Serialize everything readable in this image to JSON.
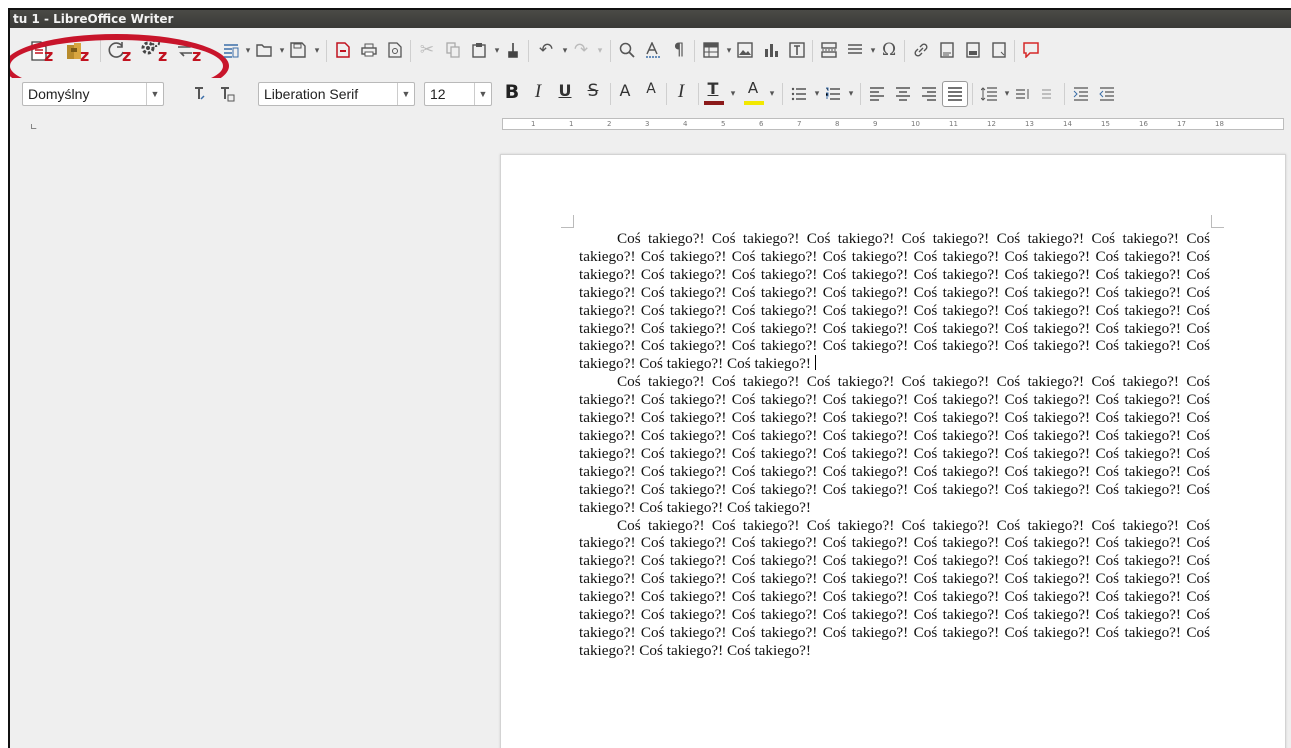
{
  "window": {
    "title": "tu 1 - LibreOffice Writer"
  },
  "toolbar1": {
    "z_letter": "z",
    "icons": [
      "document-z-icon",
      "extension-z-icon",
      "refresh-z-icon",
      "gears-z-icon",
      "transfer-z-icon",
      "sidebar-icon",
      "open-icon",
      "save-icon",
      "export-pdf-icon",
      "print-icon",
      "print-preview-icon",
      "cut-icon",
      "copy-icon",
      "paste-icon",
      "clone-formatting-icon",
      "undo-icon",
      "redo-icon",
      "find-replace-icon",
      "spelling-icon",
      "formatting-marks-icon",
      "insert-table-icon",
      "insert-image-icon",
      "insert-chart-icon",
      "insert-textbox-icon",
      "page-break-icon",
      "insert-field-icon",
      "special-character-icon",
      "hyperlink-icon",
      "footnote-icon",
      "endnote-icon",
      "bookmark-icon",
      "comment-icon"
    ]
  },
  "toolbar2": {
    "paragraph_style": "Domyślny",
    "font_name": "Liberation Serif",
    "font_size": "12",
    "bold": "B",
    "italic": "I",
    "underline": "U",
    "strikethrough": "S",
    "superscript": "A",
    "subscript": "A",
    "clear_formatting": "I",
    "font_color_letter": "T",
    "highlight_letter": "A",
    "font_color": "#8b1a1a",
    "highlight_color": "#f2e800"
  },
  "ruler": {
    "ticks": [
      "1",
      "1",
      "2",
      "3",
      "4",
      "5",
      "6",
      "7",
      "8",
      "9",
      "10",
      "11",
      "12",
      "13",
      "14",
      "15",
      "16",
      "17",
      "18"
    ]
  },
  "document": {
    "paragraphs": [
      "Coś takiego?! Coś takiego?! Coś takiego?! Coś takiego?! Coś takiego?! Coś takiego?! Coś takiego?! Coś takiego?! Coś takiego?! Coś takiego?! Coś takiego?! Coś takiego?! Coś takiego?! Coś takiego?! Coś takiego?! Coś takiego?! Coś takiego?! Coś takiego?! Coś takiego?! Coś takiego?! Coś takiego?! Coś takiego?! Coś takiego?! Coś takiego?! Coś takiego?! Coś takiego?! Coś takiego?! Coś takiego?! Coś takiego?! Coś takiego?! Coś takiego?! Coś takiego?! Coś takiego?! Coś takiego?! Coś takiego?! Coś takiego?! Coś takiego?! Coś takiego?! Coś takiego?! Coś takiego?! Coś takiego?! Coś takiego?! Coś takiego?! Coś takiego?! Coś takiego?! Coś takiego?! Coś takiego?! Coś takiego?! Coś takiego?! Coś takiego?! Coś takiego?!",
      "Coś takiego?! Coś takiego?! Coś takiego?! Coś takiego?! Coś takiego?! Coś takiego?! Coś takiego?! Coś takiego?! Coś takiego?! Coś takiego?! Coś takiego?! Coś takiego?! Coś takiego?! Coś takiego?! Coś takiego?! Coś takiego?! Coś takiego?! Coś takiego?! Coś takiego?! Coś takiego?! Coś takiego?! Coś takiego?! Coś takiego?! Coś takiego?! Coś takiego?! Coś takiego?! Coś takiego?! Coś takiego?! Coś takiego?! Coś takiego?! Coś takiego?! Coś takiego?! Coś takiego?! Coś takiego?! Coś takiego?! Coś takiego?! Coś takiego?! Coś takiego?! Coś takiego?! Coś takiego?! Coś takiego?! Coś takiego?! Coś takiego?! Coś takiego?! Coś takiego?! Coś takiego?! Coś takiego?! Coś takiego?! Coś takiego?! Coś takiego?! Coś takiego?!",
      "Coś takiego?! Coś takiego?! Coś takiego?! Coś takiego?! Coś takiego?! Coś takiego?! Coś takiego?! Coś takiego?! Coś takiego?! Coś takiego?! Coś takiego?! Coś takiego?! Coś takiego?! Coś takiego?! Coś takiego?! Coś takiego?! Coś takiego?! Coś takiego?! Coś takiego?! Coś takiego?! Coś takiego?! Coś takiego?! Coś takiego?! Coś takiego?! Coś takiego?! Coś takiego?! Coś takiego?! Coś takiego?! Coś takiego?! Coś takiego?! Coś takiego?! Coś takiego?! Coś takiego?! Coś takiego?! Coś takiego?! Coś takiego?! Coś takiego?! Coś takiego?! Coś takiego?! Coś takiego?! Coś takiego?! Coś takiego?! Coś takiego?! Coś takiego?! Coś takiego?! Coś takiego?! Coś takiego?! Coś takiego?! Coś takiego?! Coś takiego?! Coś takiego?!"
    ]
  }
}
